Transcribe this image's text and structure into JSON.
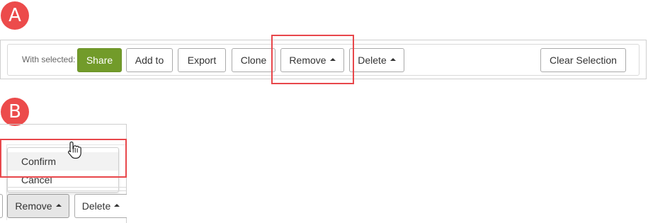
{
  "badges": {
    "a": "A",
    "b": "B"
  },
  "toolbar": {
    "with_selected": "With selected:",
    "share": "Share",
    "add_to": "Add to",
    "export": "Export",
    "clone": "Clone",
    "remove": "Remove",
    "delete": "Delete",
    "clear_selection": "Clear Selection"
  },
  "dropdown": {
    "items": [
      "Confirm",
      "Cancel"
    ]
  },
  "bottom_buttons": {
    "remove": "Remove",
    "delete": "Delete"
  },
  "colors": {
    "badge": "#ec4b4b",
    "highlight": "#e8474b",
    "share_button": "#729b2a"
  }
}
